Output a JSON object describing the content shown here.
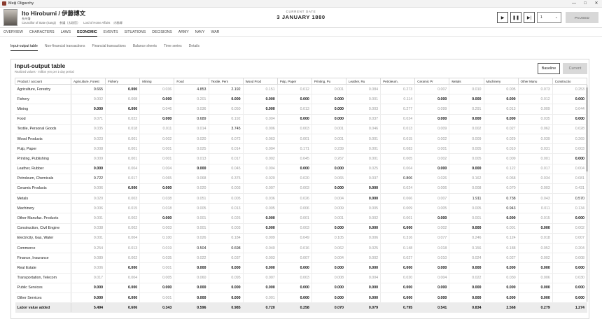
{
  "app": {
    "title": "Meiji Oligarchy"
  },
  "header": {
    "name": "Ito Hirobumi  /  伊藤博文",
    "reading": "長州藩",
    "roles": [
      "Councillor of State (Sangi)",
      "参議（太政官）",
      "Lord of Home Affairs",
      "内務卿"
    ],
    "date_label": "CURRENT DATE",
    "date_value": "3  JANUARY  1880",
    "speed_value": "1",
    "paused_label": "PAUSED"
  },
  "main_tabs": [
    "OVERVIEW",
    "CHARACTERS",
    "LAWS",
    "ECONOMIC",
    "EVENTS",
    "SITUATIONS",
    "DECISIONS",
    "ARMY",
    "NAVY",
    "WAR"
  ],
  "sub_tabs": [
    "Input-output table",
    "Non-financial transactions",
    "Financial transactions",
    "Balance sheets",
    "Time series",
    "Details"
  ],
  "panel": {
    "title": "Input-output table",
    "subtitle": "Realized values · million yen per 1-day period",
    "baseline_label": "Baseline",
    "current_label": "Current"
  },
  "table": {
    "corner": "Product / account",
    "columns": [
      "Agriculture, Forest",
      "Fishery",
      "Mining",
      "Food",
      "Textile, Pers",
      "Wood Prod",
      "Pulp, Paper",
      "Printing, Pu",
      "Leather, Ru",
      "Petroleum,",
      "Ceramic Pr",
      "Metals",
      "Machinery",
      "Other Manu",
      "Constructio"
    ],
    "rows": [
      {
        "label": "Agriculture, Forestry",
        "values": [
          "0.665",
          "0.000",
          "0.036",
          "4.853",
          "2.192",
          "0.151",
          "0.012",
          "0.001",
          "0.084",
          "0.273",
          "0.007",
          "0.010",
          "0.005",
          "0.073",
          "0.253"
        ]
      },
      {
        "label": "Fishery",
        "values": [
          "0.002",
          "0.008",
          "0.000",
          "0.201",
          "0.000",
          "0.000",
          "0.000",
          "0.000",
          "0.001",
          "0.114",
          "0.000",
          "0.000",
          "0.000",
          "0.012",
          "0.000"
        ]
      },
      {
        "label": "Mining",
        "values": [
          "0.000",
          "0.000",
          "0.046",
          "0.036",
          "0.050",
          "0.000",
          "0.013",
          "0.000",
          "0.003",
          "0.277",
          "0.099",
          "0.291",
          "0.013",
          "0.009",
          "0.044"
        ]
      },
      {
        "label": "Food",
        "values": [
          "0.071",
          "0.022",
          "0.000",
          "0.689",
          "0.192",
          "0.004",
          "0.000",
          "0.000",
          "0.037",
          "0.024",
          "0.000",
          "0.000",
          "0.000",
          "0.035",
          "0.000"
        ]
      },
      {
        "label": "Textile, Personal Goods",
        "values": [
          "0.035",
          "0.018",
          "0.011",
          "0.014",
          "3.745",
          "0.006",
          "0.003",
          "0.001",
          "0.046",
          "0.013",
          "0.009",
          "0.002",
          "0.027",
          "0.062",
          "0.028"
        ]
      },
      {
        "label": "Wood Products",
        "values": [
          "0.023",
          "0.001",
          "0.002",
          "0.020",
          "0.072",
          "0.063",
          "0.001",
          "0.001",
          "0.001",
          "0.015",
          "0.002",
          "0.009",
          "0.029",
          "0.039",
          "0.269"
        ]
      },
      {
        "label": "Pulp, Paper",
        "values": [
          "0.008",
          "0.001",
          "0.001",
          "0.025",
          "0.014",
          "0.004",
          "0.171",
          "0.239",
          "0.001",
          "0.083",
          "0.001",
          "0.005",
          "0.010",
          "0.031",
          "0.003"
        ]
      },
      {
        "label": "Printing, Publishing",
        "values": [
          "0.009",
          "0.001",
          "0.001",
          "0.013",
          "0.017",
          "0.002",
          "0.045",
          "0.267",
          "0.001",
          "0.005",
          "0.002",
          "0.005",
          "0.009",
          "0.001",
          "0.000"
        ]
      },
      {
        "label": "Leather, Rubber",
        "values": [
          "0.000",
          "0.004",
          "0.004",
          "0.000",
          "0.045",
          "0.004",
          "0.000",
          "0.000",
          "0.025",
          "0.004",
          "0.000",
          "0.000",
          "0.122",
          "0.017",
          "0.004"
        ]
      },
      {
        "label": "Petroleum, Chemicals",
        "values": [
          "0.722",
          "0.017",
          "0.065",
          "0.068",
          "0.375",
          "0.020",
          "0.020",
          "0.065",
          "0.037",
          "0.806",
          "0.026",
          "0.162",
          "0.068",
          "0.034",
          "0.081"
        ]
      },
      {
        "label": "Ceramic Products",
        "values": [
          "0.006",
          "0.000",
          "0.000",
          "0.020",
          "0.003",
          "0.007",
          "0.003",
          "0.000",
          "0.000",
          "0.024",
          "0.006",
          "0.008",
          "0.070",
          "0.003",
          "0.431"
        ]
      },
      {
        "label": "Metals",
        "values": [
          "0.020",
          "0.003",
          "0.038",
          "0.051",
          "0.005",
          "0.036",
          "0.026",
          "0.004",
          "0.000",
          "0.066",
          "0.007",
          "1.911",
          "0.738",
          "0.043",
          "0.570"
        ]
      },
      {
        "label": "Machinery",
        "values": [
          "0.006",
          "0.015",
          "0.018",
          "0.005",
          "0.013",
          "0.005",
          "0.006",
          "0.009",
          "0.005",
          "0.009",
          "0.005",
          "0.005",
          "0.943",
          "0.011",
          "0.134"
        ]
      },
      {
        "label": "Other Manufac. Products",
        "values": [
          "0.001",
          "0.002",
          "0.000",
          "0.001",
          "0.026",
          "0.000",
          "0.001",
          "0.001",
          "0.002",
          "0.001",
          "0.000",
          "0.001",
          "0.000",
          "0.015",
          "0.000"
        ]
      },
      {
        "label": "Construction, Civil Engine",
        "values": [
          "0.038",
          "0.002",
          "0.003",
          "0.001",
          "0.003",
          "0.000",
          "0.003",
          "0.000",
          "0.000",
          "0.000",
          "0.002",
          "0.000",
          "0.001",
          "0.000",
          "0.002"
        ]
      },
      {
        "label": "Electricity, Gas, Water",
        "values": [
          "0.001",
          "0.004",
          "0.100",
          "0.026",
          "0.184",
          "0.009",
          "0.049",
          "0.105",
          "0.006",
          "0.316",
          "0.077",
          "0.246",
          "0.124",
          "0.018",
          "0.007"
        ]
      },
      {
        "label": "Commerce",
        "values": [
          "0.254",
          "0.013",
          "0.019",
          "0.504",
          "0.698",
          "0.040",
          "0.016",
          "0.062",
          "0.025",
          "0.148",
          "0.018",
          "0.156",
          "0.188",
          "0.052",
          "0.204"
        ]
      },
      {
        "label": "Finance, Insurance",
        "values": [
          "0.089",
          "0.002",
          "0.035",
          "0.022",
          "0.037",
          "0.003",
          "0.007",
          "0.004",
          "0.002",
          "0.027",
          "0.010",
          "0.024",
          "0.027",
          "0.002",
          "0.008"
        ]
      },
      {
        "label": "Real Estate",
        "values": [
          "0.006",
          "0.000",
          "0.001",
          "0.000",
          "0.000",
          "0.000",
          "0.000",
          "0.000",
          "0.000",
          "0.000",
          "0.000",
          "0.000",
          "0.000",
          "0.000",
          "0.000"
        ]
      },
      {
        "label": "Transportation, Telecom",
        "values": [
          "0.017",
          "0.004",
          "0.005",
          "0.060",
          "0.095",
          "0.007",
          "0.003",
          "0.008",
          "0.004",
          "0.020",
          "0.004",
          "0.022",
          "0.030",
          "0.006",
          "0.030"
        ]
      },
      {
        "label": "Public Services",
        "values": [
          "0.000",
          "0.000",
          "0.000",
          "0.000",
          "0.000",
          "0.000",
          "0.000",
          "0.000",
          "0.000",
          "0.000",
          "0.000",
          "0.000",
          "0.000",
          "0.000",
          "0.000"
        ]
      },
      {
        "label": "Other Services",
        "values": [
          "0.000",
          "0.000",
          "0.001",
          "0.000",
          "0.000",
          "0.001",
          "0.000",
          "0.000",
          "0.000",
          "0.000",
          "0.000",
          "0.000",
          "0.000",
          "0.000",
          "0.000"
        ]
      }
    ],
    "total": {
      "label": "Labor value added",
      "values": [
        "5.494",
        "0.606",
        "0.343",
        "0.596",
        "0.985",
        "0.720",
        "0.258",
        "0.070",
        "0.079",
        "0.795",
        "0.541",
        "0.834",
        "2.568",
        "0.279",
        "1.274"
      ]
    }
  }
}
